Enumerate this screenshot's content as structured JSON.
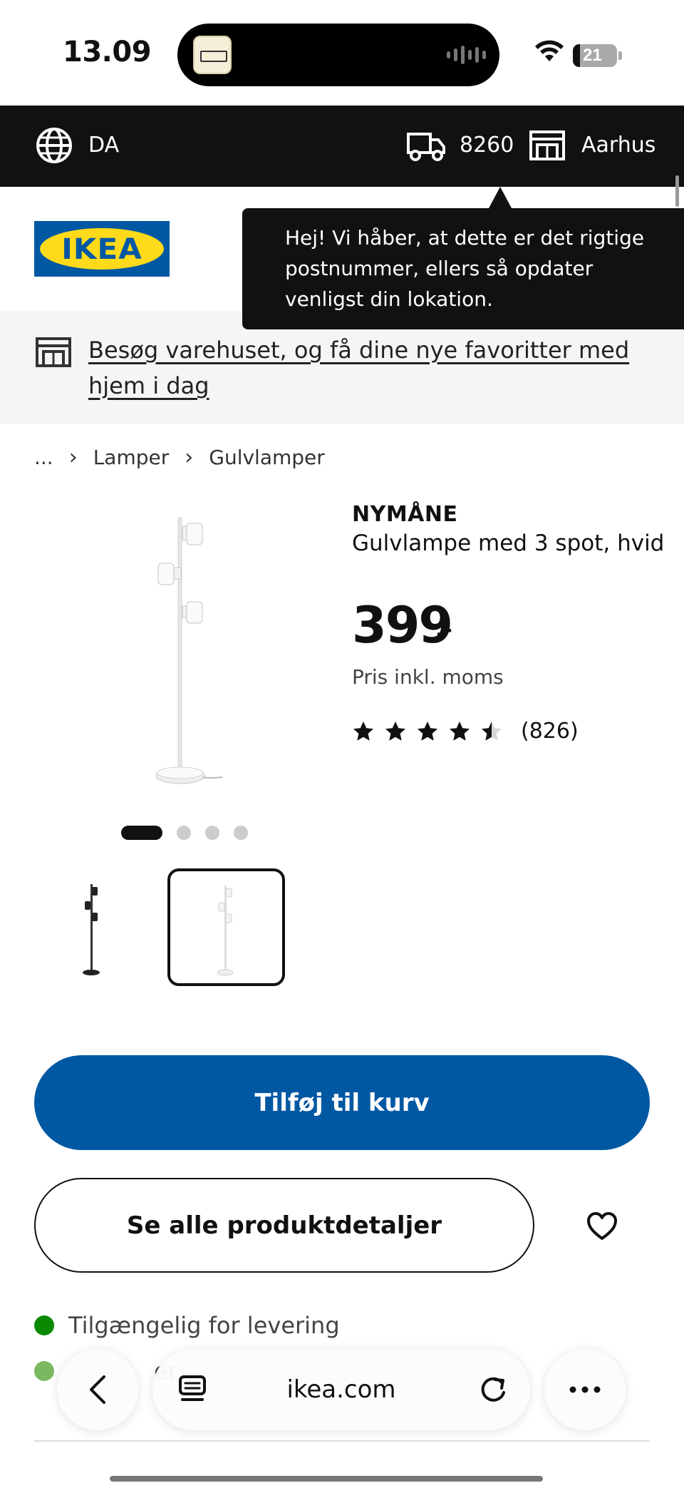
{
  "status_bar": {
    "time": "13.09",
    "battery": "21"
  },
  "top_bar": {
    "language": "DA",
    "postal_code": "8260",
    "store": "Aarhus"
  },
  "header": {
    "logo_text": "IKEA"
  },
  "tooltip": {
    "text": "Hej! Vi håber, at dette er det rigtige postnummer, ellers så opdater venligst din lokation."
  },
  "banner": {
    "text": "Besøg varehuset, og få dine nye favoritter med hjem i dag"
  },
  "breadcrumb": {
    "ellipsis": "...",
    "separator": "›",
    "items": [
      "Lamper",
      "Gulvlamper"
    ]
  },
  "product": {
    "name": "NYMÅNE",
    "description": "Gulvlampe med 3 spot, hvid",
    "price": "399",
    "price_suffix": ".-",
    "price_note": "Pris inkl. moms",
    "rating": 4.5,
    "rating_max": 5,
    "review_count": "(826)",
    "image_count": 4,
    "active_image": 1
  },
  "buttons": {
    "add_to_cart": "Tilføj til kurv",
    "see_details": "Se alle produktdetaljer"
  },
  "availability": {
    "delivery": "Tilgængelig for levering",
    "store_partial": "er"
  },
  "browser": {
    "url": "ikea.com"
  },
  "colors": {
    "brand_blue": "#0058a3",
    "brand_yellow": "#ffda1a",
    "available_green": "#0a8a00"
  }
}
